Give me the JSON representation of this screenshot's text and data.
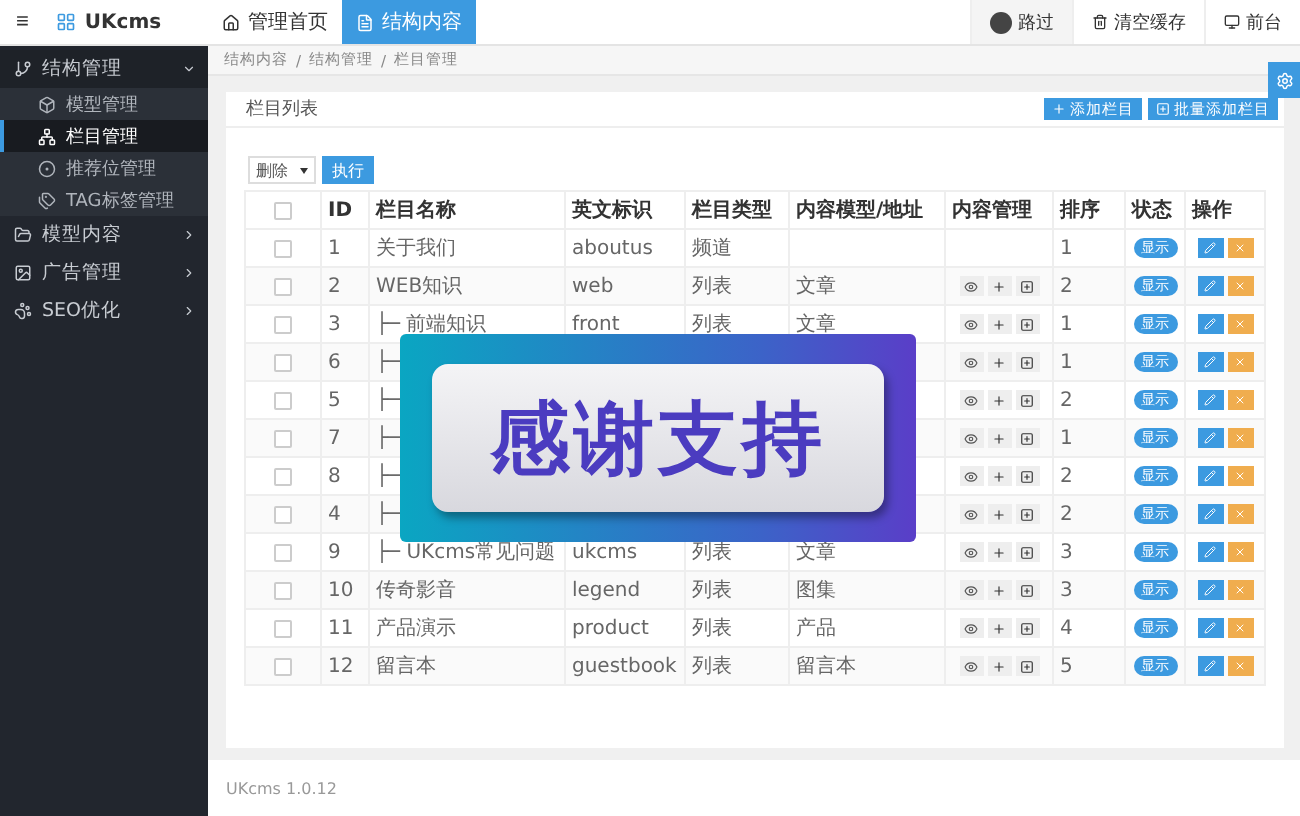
{
  "topbar": {
    "menu_glyph": "≡",
    "logo": "UKcms",
    "tabs": [
      {
        "label": "管理首页",
        "selected": false
      },
      {
        "label": "结构内容",
        "selected": true
      }
    ],
    "user": "路过",
    "actions": [
      {
        "label": "清空缓存"
      },
      {
        "label": "前台"
      }
    ]
  },
  "sidebar": {
    "items": [
      {
        "label": "结构管理",
        "expanded": true,
        "children": [
          {
            "label": "模型管理",
            "selected": false
          },
          {
            "label": "栏目管理",
            "selected": true
          },
          {
            "label": "推荐位管理",
            "selected": false
          },
          {
            "label": "TAG标签管理",
            "selected": false
          }
        ]
      },
      {
        "label": "模型内容",
        "expanded": false
      },
      {
        "label": "广告管理",
        "expanded": false
      },
      {
        "label": "SEO优化",
        "expanded": false
      }
    ]
  },
  "breadcrumb": {
    "separator": "/",
    "items": [
      "结构内容",
      "结构管理",
      "栏目管理"
    ]
  },
  "card": {
    "title": "栏目列表",
    "buttons": [
      {
        "label": "添加栏目"
      },
      {
        "label": "批量添加栏目"
      }
    ],
    "bulk_select": "删除",
    "execute": "执行",
    "select_all_checked": false,
    "columns": [
      "ID",
      "栏目名称",
      "英文标识",
      "栏目类型",
      "内容模型/地址",
      "内容管理",
      "排序",
      "状态",
      "操作"
    ],
    "rows": [
      {
        "checked": false,
        "id": "1",
        "name": "关于我们",
        "en": "aboutus",
        "type": "频道",
        "content_tools": false,
        "order": "1",
        "status": "显示"
      },
      {
        "checked": false,
        "id": "2",
        "name": "WEB知识",
        "en": "web",
        "type": "列表",
        "model": "文章",
        "content_tools": true,
        "order": "2",
        "status": "显示"
      },
      {
        "checked": false,
        "id": "3",
        "name": "├─ 前端知识",
        "en": "front",
        "type": "列表",
        "model": "文章",
        "content_tools": true,
        "order": "1",
        "status": "显示"
      },
      {
        "checked": false,
        "id": "6",
        "name": "├─",
        "content_tools": true,
        "order": "1",
        "status": "显示"
      },
      {
        "checked": false,
        "id": "5",
        "name": "├─",
        "content_tools": true,
        "order": "2",
        "status": "显示"
      },
      {
        "checked": false,
        "id": "7",
        "name": "├─",
        "content_tools": true,
        "order": "1",
        "status": "显示"
      },
      {
        "checked": false,
        "id": "8",
        "name": "├─",
        "content_tools": true,
        "order": "2",
        "status": "显示"
      },
      {
        "checked": false,
        "id": "4",
        "name": "├─",
        "content_tools": true,
        "order": "2",
        "status": "显示"
      },
      {
        "checked": false,
        "id": "9",
        "name": "├─ UKcms常见问题",
        "en": "ukcms",
        "type": "列表",
        "model": "文章",
        "content_tools": true,
        "order": "3",
        "status": "显示"
      },
      {
        "checked": false,
        "id": "10",
        "name": "传奇影音",
        "en": "legend",
        "type": "列表",
        "model": "图集",
        "content_tools": true,
        "order": "3",
        "status": "显示"
      },
      {
        "checked": false,
        "id": "11",
        "name": "产品演示",
        "en": "product",
        "type": "列表",
        "model": "产品",
        "content_tools": true,
        "order": "4",
        "status": "显示"
      },
      {
        "checked": false,
        "id": "12",
        "name": "留言本",
        "en": "guestbook",
        "type": "列表",
        "model": "留言本",
        "content_tools": true,
        "order": "5",
        "status": "显示"
      }
    ]
  },
  "footer": "UKcms 1.0.12",
  "overlay": {
    "text": "感谢支持"
  }
}
